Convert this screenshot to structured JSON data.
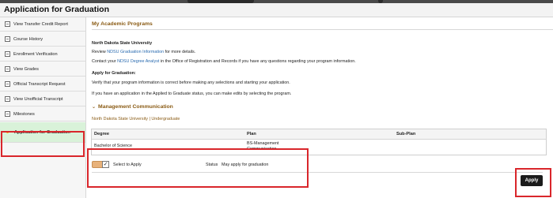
{
  "page": {
    "title": "Application for Graduation"
  },
  "sidebar": {
    "items": [
      {
        "label": "View Transfer Credit Report"
      },
      {
        "label": "Course History"
      },
      {
        "label": "Enrollment Verification"
      },
      {
        "label": "View Grades"
      },
      {
        "label": "Official Transcript Request"
      },
      {
        "label": "View Unofficial Transcript"
      },
      {
        "label": "Milestones"
      },
      {
        "label": "Application for Graduation"
      }
    ]
  },
  "main": {
    "section_title": "My Academic Programs",
    "institution": "North Dakota State University",
    "review_prefix": "Review ",
    "review_link": "NDSU Graduation Information",
    "review_suffix": " for more details.",
    "contact_prefix": "Contact your ",
    "contact_link": "NDSU Degree Analyst",
    "contact_suffix": " in the Office of Registration and Records if you have any questions regarding your program information.",
    "apply_heading": "Apply for Graduation:",
    "verify_text": "Verify that your program information is correct before making any selections and starting your application.",
    "applied_text": "If you have an application in the Applied to Graduate status, you can make edits by selecting the program.",
    "program": {
      "collapse_glyph": "⌄",
      "name": "Management Communication",
      "subtitle": "North Dakota State University | Undergraduate",
      "columns": [
        "Degree",
        "Plan",
        "Sub-Plan"
      ],
      "row": {
        "degree": "Bachelor of Science",
        "plan_line1": "BS-Management",
        "plan_line2": "Communication",
        "subplan": ""
      }
    },
    "select_label": "Select to Apply",
    "checkbox_mark": "✓",
    "status_label": "Status",
    "status_value": "May apply for graduation",
    "apply_button": "Apply"
  }
}
